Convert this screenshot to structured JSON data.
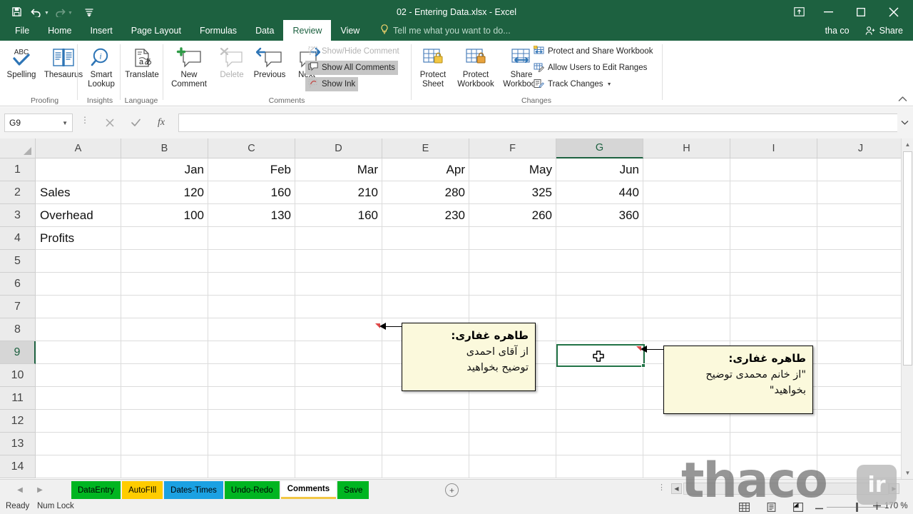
{
  "window": {
    "title": "02 - Entering Data.xlsx - Excel",
    "quick_access": [
      {
        "name": "save-icon",
        "glyph": "ὋE"
      },
      {
        "name": "undo-icon",
        "glyph": "↶"
      },
      {
        "name": "redo-icon",
        "glyph": "↷"
      },
      {
        "name": "customize-qat-icon",
        "glyph": "☷"
      }
    ],
    "ribbon_display_options": "⬒",
    "minimize": "—",
    "restore": "☐",
    "close": "✕",
    "user": "tha co",
    "share_label": "Share",
    "share_icon": "☺"
  },
  "ribbon": {
    "tabs": [
      {
        "label": "File",
        "active": false
      },
      {
        "label": "Home",
        "active": false
      },
      {
        "label": "Insert",
        "active": false
      },
      {
        "label": "Page Layout",
        "active": false
      },
      {
        "label": "Formulas",
        "active": false
      },
      {
        "label": "Data",
        "active": false
      },
      {
        "label": "Review",
        "active": true
      },
      {
        "label": "View",
        "active": false
      }
    ],
    "tell_me": "Tell me what you want to do...",
    "groups": [
      {
        "label": "Proofing"
      },
      {
        "label": "Insights"
      },
      {
        "label": "Language"
      },
      {
        "label": "Comments"
      },
      {
        "label": "Changes"
      }
    ],
    "buttons": {
      "spelling": "Spelling",
      "spelling_badge": "ABC",
      "thesaurus": "Thesaurus",
      "smart_lookup_l1": "Smart",
      "smart_lookup_l2": "Lookup",
      "translate": "Translate",
      "new_comment_l1": "New",
      "new_comment_l2": "Comment",
      "delete": "Delete",
      "previous": "Previous",
      "next": "Next",
      "show_hide_comment": "Show/Hide Comment",
      "show_all_comments": "Show All Comments",
      "show_ink": "Show Ink",
      "protect_sheet_l1": "Protect",
      "protect_sheet_l2": "Sheet",
      "protect_workbook_l1": "Protect",
      "protect_workbook_l2": "Workbook",
      "share_workbook_l1": "Share",
      "share_workbook_l2": "Workbook",
      "protect_and_share": "Protect and Share Workbook",
      "allow_users": "Allow Users to Edit Ranges",
      "track_changes": "Track Changes",
      "collapse": "⌃"
    }
  },
  "formula_bar": {
    "name_box": "G9",
    "cancel_icon": "✕",
    "enter_icon": "✓",
    "fx_icon": "fx",
    "value": "",
    "expand_icon": "⌄"
  },
  "grid": {
    "columns": [
      "A",
      "B",
      "C",
      "D",
      "E",
      "F",
      "G",
      "H",
      "I",
      "J"
    ],
    "selected_column": "G",
    "rows": [
      "1",
      "2",
      "3",
      "4",
      "5",
      "6",
      "7",
      "8",
      "9",
      "10",
      "11",
      "12",
      "13",
      "14"
    ],
    "selected_row": "9",
    "selected_cell": "G9",
    "data": [
      {
        "row": "1",
        "A": "",
        "B": "Jan",
        "C": "Feb",
        "D": "Mar",
        "E": "Apr",
        "F": "May",
        "G": "Jun"
      },
      {
        "row": "2",
        "A": "Sales",
        "B": "120",
        "C": "160",
        "D": "210",
        "E": "280",
        "F": "325",
        "G": "440"
      },
      {
        "row": "3",
        "A": "Overhead",
        "B": "100",
        "C": "130",
        "D": "160",
        "E": "230",
        "F": "260",
        "G": "360"
      },
      {
        "row": "4",
        "A": "Profits",
        "B": "",
        "C": "",
        "D": "",
        "E": "",
        "F": "",
        "G": ""
      }
    ]
  },
  "comments": [
    {
      "anchor_cell": "D2",
      "author": "طاهره غفاری:",
      "line1": "از آقای احمدی",
      "line2": "توضیح بخواهید"
    },
    {
      "anchor_cell": "G3",
      "author": "طاهره غفاری:",
      "line1": "\"از خانم محمدی توضیح",
      "line2": "بخواهید\""
    }
  ],
  "sheet_tabs": {
    "prev_icon": "◀",
    "next_icon": "▶",
    "items": [
      {
        "label": "DataEntry",
        "color": "#00B521",
        "text_color": "#000000",
        "active": false
      },
      {
        "label": "AutoFIll",
        "color": "#FFCC00",
        "text_color": "#000000",
        "active": false
      },
      {
        "label": "Dates-Times",
        "color": "#1BA1E2",
        "text_color": "#000000",
        "active": false
      },
      {
        "label": "Undo-Redo",
        "color": "#00B521",
        "text_color": "#000000",
        "active": false
      },
      {
        "label": "Comments",
        "color": "#FFFFFF",
        "text_color": "#000000",
        "active": true
      },
      {
        "label": "Save",
        "color": "#00B521",
        "text_color": "#000000",
        "active": false
      }
    ],
    "add_sheet_icon": "+"
  },
  "status_bar": {
    "state": "Ready",
    "num_lock": "Num Lock",
    "view_normal_icon": "▦",
    "view_pagelayout_icon": "▤",
    "view_pagebreak_icon": "▣",
    "zoom_out": "−",
    "zoom_in": "+",
    "zoom_value": "170 %"
  },
  "watermark": {
    "text": "thaco",
    "badge": "ir"
  },
  "theme": {
    "title_green": "#1d6140",
    "accent_green": "#217346",
    "comment_bg": "#fbf9dc",
    "header_gray": "#ebebeb"
  }
}
